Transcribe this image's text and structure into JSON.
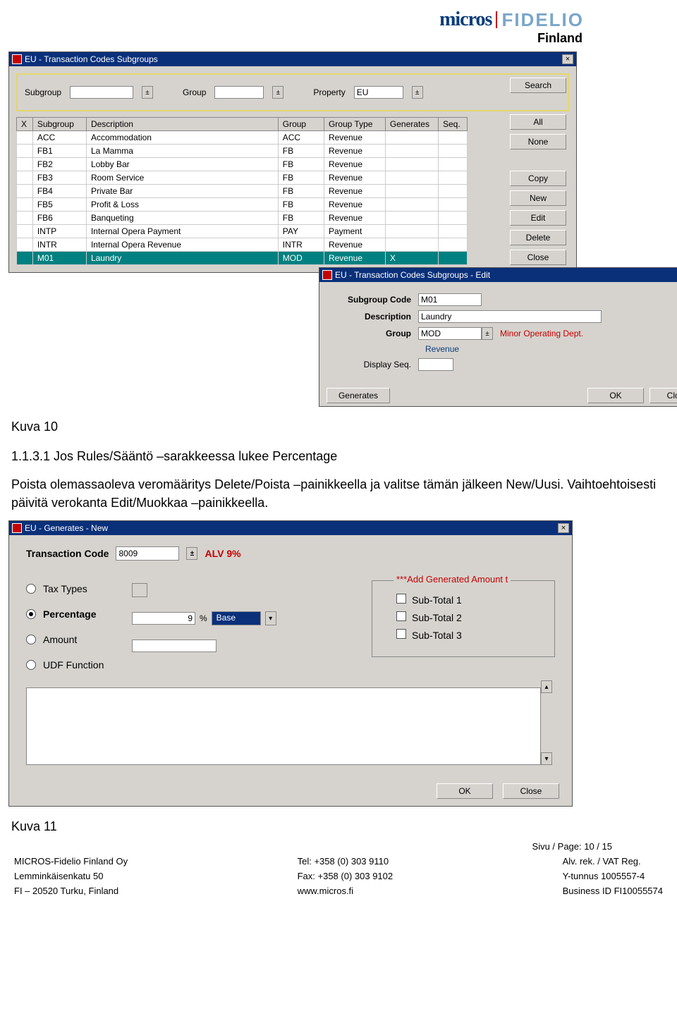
{
  "header": {
    "brand_left": "micros",
    "brand_right": "FIDELIO",
    "country": "Finland"
  },
  "win_subgroups": {
    "title": "EU - Transaction Codes Subgroups",
    "filters": {
      "subgroup_label": "Subgroup",
      "subgroup_value": "",
      "group_label": "Group",
      "group_value": "",
      "property_label": "Property",
      "property_value": "EU"
    },
    "columns": [
      "X",
      "Subgroup",
      "Description",
      "Group",
      "Group Type",
      "Generates",
      "Seq."
    ],
    "rows": [
      {
        "x": "",
        "sub": "ACC",
        "desc": "Accommodation",
        "grp": "ACC",
        "gt": "Revenue",
        "gen": "",
        "seq": ""
      },
      {
        "x": "",
        "sub": "FB1",
        "desc": "La Mamma",
        "grp": "FB",
        "gt": "Revenue",
        "gen": "",
        "seq": ""
      },
      {
        "x": "",
        "sub": "FB2",
        "desc": "Lobby Bar",
        "grp": "FB",
        "gt": "Revenue",
        "gen": "",
        "seq": ""
      },
      {
        "x": "",
        "sub": "FB3",
        "desc": "Room Service",
        "grp": "FB",
        "gt": "Revenue",
        "gen": "",
        "seq": ""
      },
      {
        "x": "",
        "sub": "FB4",
        "desc": "Private Bar",
        "grp": "FB",
        "gt": "Revenue",
        "gen": "",
        "seq": ""
      },
      {
        "x": "",
        "sub": "FB5",
        "desc": "Profit & Loss",
        "grp": "FB",
        "gt": "Revenue",
        "gen": "",
        "seq": ""
      },
      {
        "x": "",
        "sub": "FB6",
        "desc": "Banqueting",
        "grp": "FB",
        "gt": "Revenue",
        "gen": "",
        "seq": ""
      },
      {
        "x": "",
        "sub": "INTP",
        "desc": "Internal Opera Payment",
        "grp": "PAY",
        "gt": "Payment",
        "gen": "",
        "seq": ""
      },
      {
        "x": "",
        "sub": "INTR",
        "desc": "Internal Opera Revenue",
        "grp": "INTR",
        "gt": "Revenue",
        "gen": "",
        "seq": ""
      },
      {
        "x": "",
        "sub": "M01",
        "desc": "Laundry",
        "grp": "MOD",
        "gt": "Revenue",
        "gen": "X",
        "seq": ""
      }
    ],
    "selected_index": 9,
    "buttons": {
      "search": "Search",
      "all": "All",
      "none": "None",
      "copy": "Copy",
      "new": "New",
      "edit": "Edit",
      "delete": "Delete",
      "close": "Close"
    }
  },
  "win_edit": {
    "title": "EU - Transaction Codes Subgroups - Edit",
    "fields": {
      "subgroup_code_label": "Subgroup Code",
      "subgroup_code_value": "M01",
      "description_label": "Description",
      "description_value": "Laundry",
      "group_label": "Group",
      "group_value": "MOD",
      "group_hint": "Minor Operating Dept.",
      "group_sub": "Revenue",
      "displayseq_label": "Display Seq.",
      "displayseq_value": ""
    },
    "buttons": {
      "generates": "Generates",
      "ok": "OK",
      "close": "Close"
    }
  },
  "doc": {
    "kuva10": "Kuva 10",
    "h3": "1.1.3.1  Jos Rules/Sääntö –sarakkeessa lukee Percentage",
    "p": "Poista olemassaoleva veromääritys Delete/Poista –painikkeella ja valitse tämän jälkeen New/Uusi. Vaihtoehtoisesti päivitä verokanta Edit/Muokkaa –painikkeella.",
    "kuva11": "Kuva 11"
  },
  "win_gen": {
    "title": "EU - Generates - New",
    "tcode_label": "Transaction Code",
    "tcode_value": "8009",
    "tcode_hint": "ALV 9%",
    "radios": {
      "tax": "Tax Types",
      "percentage": "Percentage",
      "amount": "Amount",
      "udf": "UDF Function"
    },
    "selected_radio": "percentage",
    "percentage_value": "9",
    "percentage_unit": "%",
    "base_label": "Base",
    "addbox": {
      "legend": "***Add Generated Amount t",
      "sub1": "Sub-Total 1",
      "sub2": "Sub-Total 2",
      "sub3": "Sub-Total 3"
    },
    "buttons": {
      "ok": "OK",
      "close": "Close"
    }
  },
  "footer": {
    "page": "Sivu / Page: 10 / 15",
    "col1": {
      "l1": "MICROS-Fidelio Finland Oy",
      "l2": "Lemminkäisenkatu 50",
      "l3": "FI – 20520 Turku, Finland"
    },
    "col2": {
      "l1": "Tel: +358 (0) 303 9110",
      "l2": "Fax: +358 (0) 303 9102",
      "l3": "www.micros.fi"
    },
    "col3": {
      "l1": "Alv. rek. / VAT Reg.",
      "l2": "Y-tunnus 1005557-4",
      "l3": "Business ID FI10055574"
    }
  }
}
